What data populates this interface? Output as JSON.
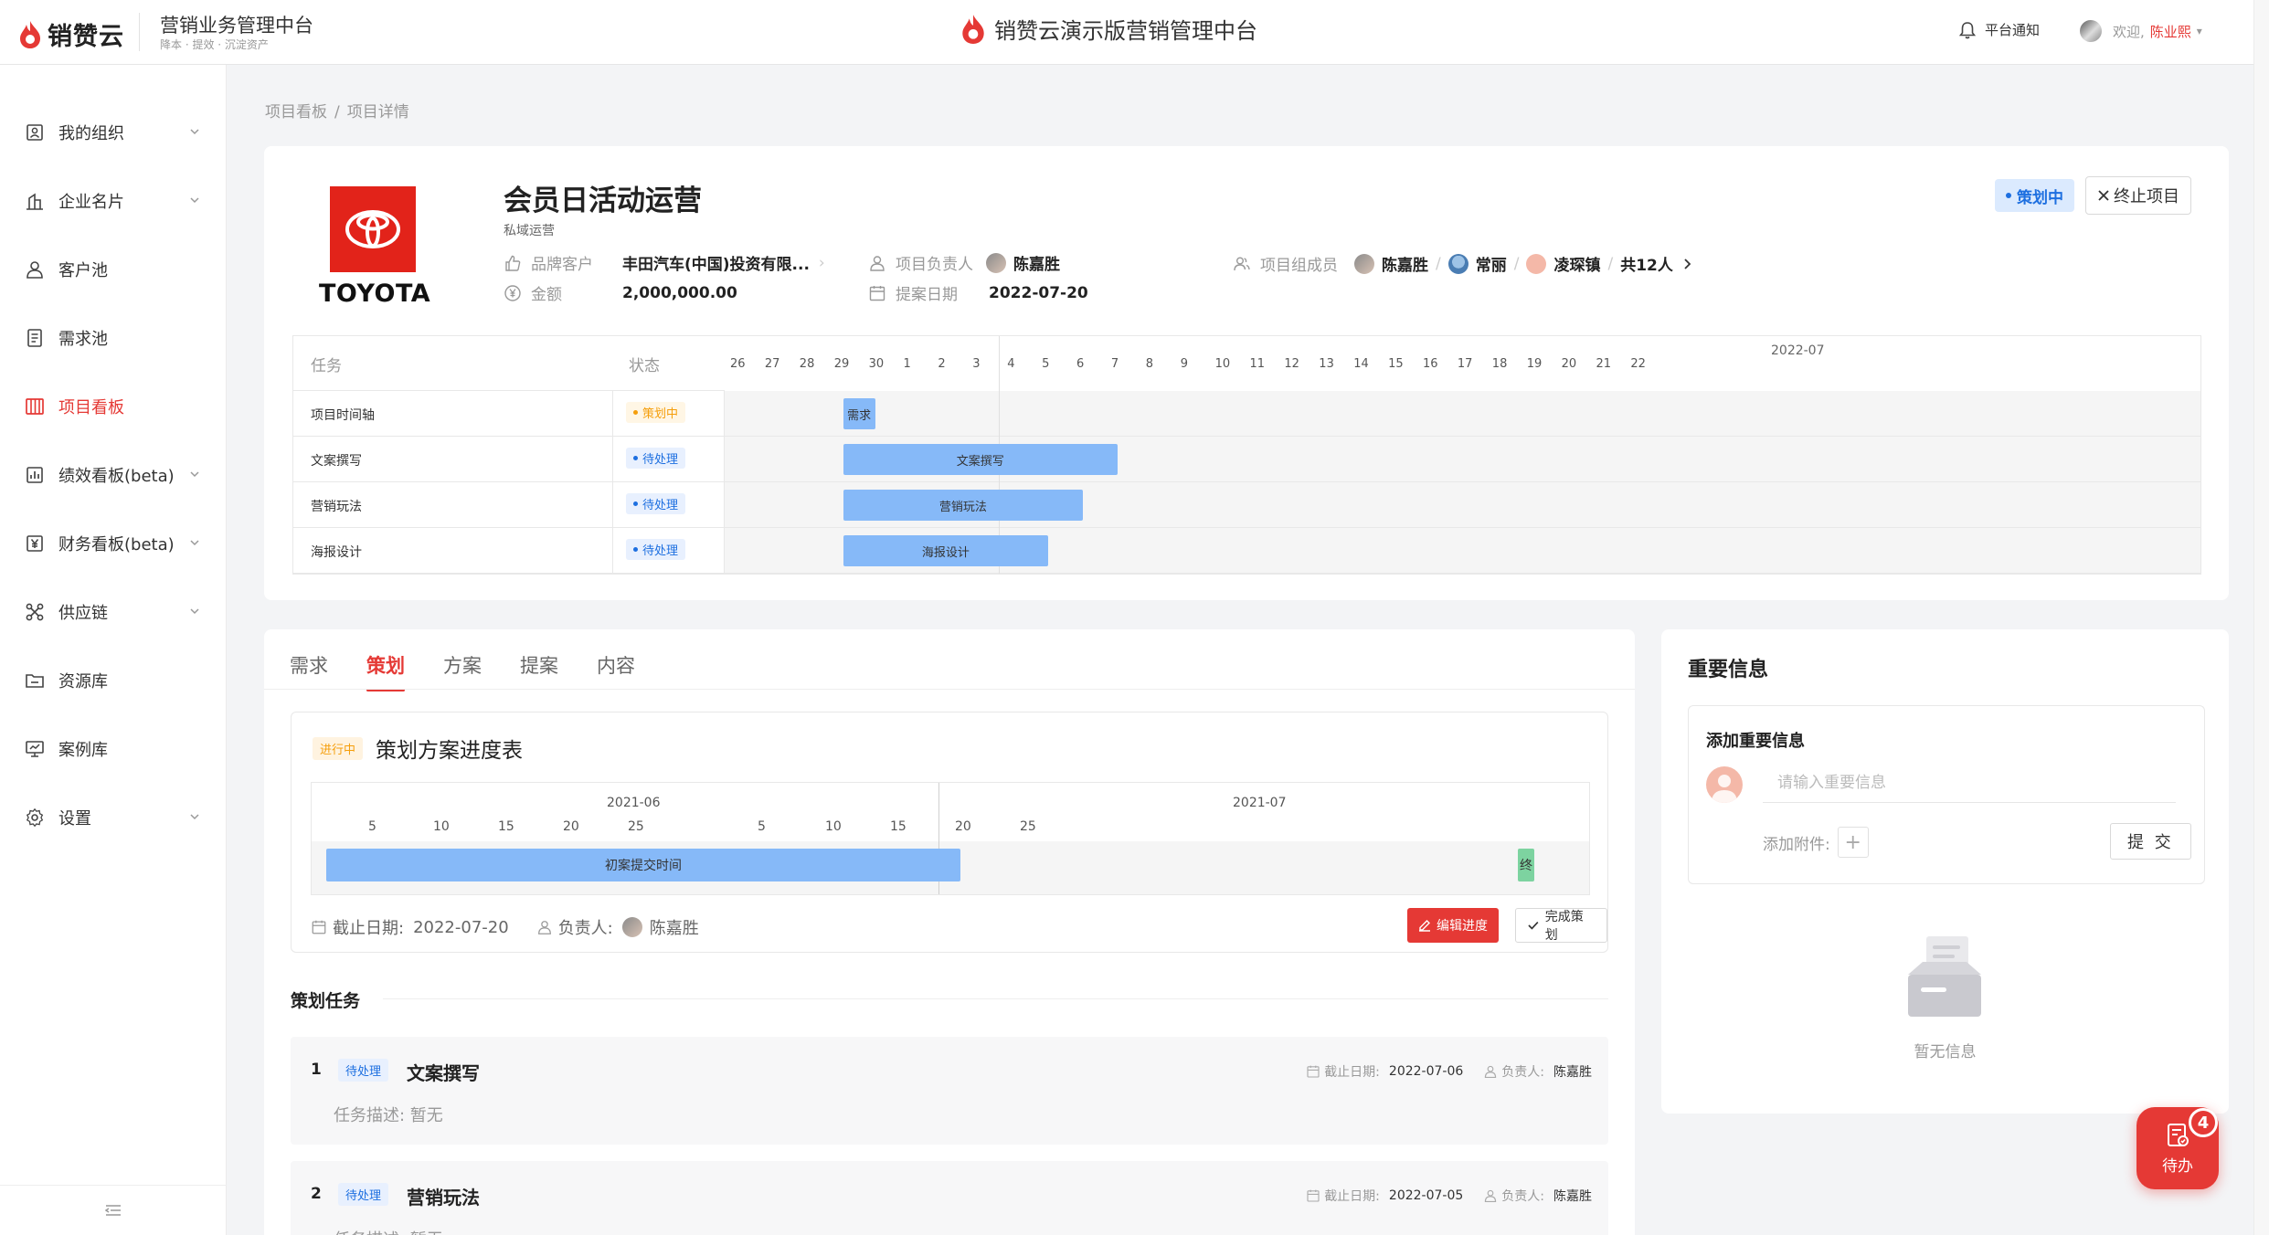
{
  "topbar": {
    "logo_text": "销赞云",
    "system_title": "营销业务管理中台",
    "system_subtitle": "降本 · 提效 · 沉淀资产",
    "center_title": "销赞云演示版营销管理中台",
    "notice_label": "平台通知",
    "welcome": "欢迎,",
    "user_name": "陈业熙"
  },
  "sidebar": {
    "items": [
      {
        "label": "我的组织",
        "icon": "org-icon",
        "expandable": true
      },
      {
        "label": "企业名片",
        "icon": "building-icon",
        "expandable": true
      },
      {
        "label": "客户池",
        "icon": "user-icon",
        "expandable": false
      },
      {
        "label": "需求池",
        "icon": "clipboard-icon",
        "expandable": false
      },
      {
        "label": "项目看板",
        "icon": "kanban-icon",
        "expandable": false,
        "active": true
      },
      {
        "label": "绩效看板(beta)",
        "icon": "chart-icon",
        "expandable": true
      },
      {
        "label": "财务看板(beta)",
        "icon": "yen-icon",
        "expandable": true
      },
      {
        "label": "供应链",
        "icon": "network-icon",
        "expandable": true
      },
      {
        "label": "资源库",
        "icon": "folder-icon",
        "expandable": false
      },
      {
        "label": "案例库",
        "icon": "presentation-icon",
        "expandable": false
      },
      {
        "label": "设置",
        "icon": "gear-icon",
        "expandable": true
      }
    ]
  },
  "breadcrumb": [
    "项目看板",
    "项目详情"
  ],
  "project": {
    "brand_logo_text": "TOYOTA",
    "name": "会员日活动运营",
    "type": "私域运营",
    "status": "策划中",
    "end_button": "终止项目",
    "brand_customer_label": "品牌客户",
    "brand_customer_value": "丰田汽车(中国)投资有限...",
    "amount_label": "金额",
    "amount_value": "2,000,000.00",
    "owner_label": "项目负责人",
    "owner_value": "陈嘉胜",
    "proposal_date_label": "提案日期",
    "proposal_date_value": "2022-07-20",
    "members_label": "项目组成员",
    "members": [
      "陈嘉胜",
      "常丽",
      "凌琛镇"
    ],
    "members_total": "共12人"
  },
  "project_gantt": {
    "header_task": "任务",
    "header_status": "状态",
    "month": "2022-07",
    "days": [
      "26",
      "27",
      "28",
      "29",
      "30",
      "1",
      "2",
      "3",
      "4",
      "5",
      "6",
      "7",
      "8",
      "9",
      "10",
      "11",
      "12",
      "13",
      "14",
      "15",
      "16",
      "17",
      "18",
      "19",
      "20",
      "21",
      "22"
    ],
    "rows": [
      {
        "task": "项目时间轴",
        "status": "策划中",
        "status_type": "warn",
        "bar_label": "需求",
        "start": "2022-06-29",
        "end": "2022-06-29"
      },
      {
        "task": "文案撰写",
        "status": "待处理",
        "status_type": "info",
        "bar_label": "文案撰写",
        "start": "2022-06-29",
        "end": "2022-07-06"
      },
      {
        "task": "营销玩法",
        "status": "待处理",
        "status_type": "info",
        "bar_label": "营销玩法",
        "start": "2022-06-29",
        "end": "2022-07-05"
      },
      {
        "task": "海报设计",
        "status": "待处理",
        "status_type": "info",
        "bar_label": "海报设计",
        "start": "2022-06-29",
        "end": "2022-07-04"
      }
    ]
  },
  "tabs": [
    "需求",
    "策划",
    "方案",
    "提案",
    "内容"
  ],
  "active_tab": "策划",
  "plan_progress": {
    "tag": "进行中",
    "title": "策划方案进度表",
    "months": [
      "2021-06",
      "2021-07"
    ],
    "june_days": [
      "5",
      "10",
      "15",
      "20",
      "25"
    ],
    "july_days": [
      "5",
      "10",
      "15",
      "20",
      "25"
    ],
    "bar_label": "初案提交时间",
    "end_marker": "终",
    "deadline_label": "截止日期:",
    "deadline_value": "2022-07-20",
    "owner_label": "负责人:",
    "owner_value": "陈嘉胜",
    "edit_button": "编辑进度",
    "done_button": "完成策划"
  },
  "plan_tasks": {
    "title": "策划任务",
    "items": [
      {
        "num": "1",
        "status": "待处理",
        "name": "文案撰写",
        "deadline_label": "截止日期:",
        "deadline": "2022-07-06",
        "owner_label": "负责人:",
        "owner": "陈嘉胜",
        "desc": "任务描述:  暂无"
      },
      {
        "num": "2",
        "status": "待处理",
        "name": "营销玩法",
        "deadline_label": "截止日期:",
        "deadline": "2022-07-05",
        "owner_label": "负责人:",
        "owner": "陈嘉胜",
        "desc": "任务描述:  暂无"
      }
    ]
  },
  "important_info": {
    "title": "重要信息",
    "add_title": "添加重要信息",
    "input_placeholder": "请输入重要信息",
    "attachment_label": "添加附件:",
    "submit": "提 交",
    "empty_text": "暂无信息"
  },
  "todo": {
    "label": "待办",
    "count": "4"
  },
  "colors": {
    "brand_red": "#e53935",
    "bar_blue": "#86b9f8",
    "status_blue": "#1d6fe0",
    "status_orange": "#f59e0b",
    "end_green": "#7dd3a0"
  }
}
